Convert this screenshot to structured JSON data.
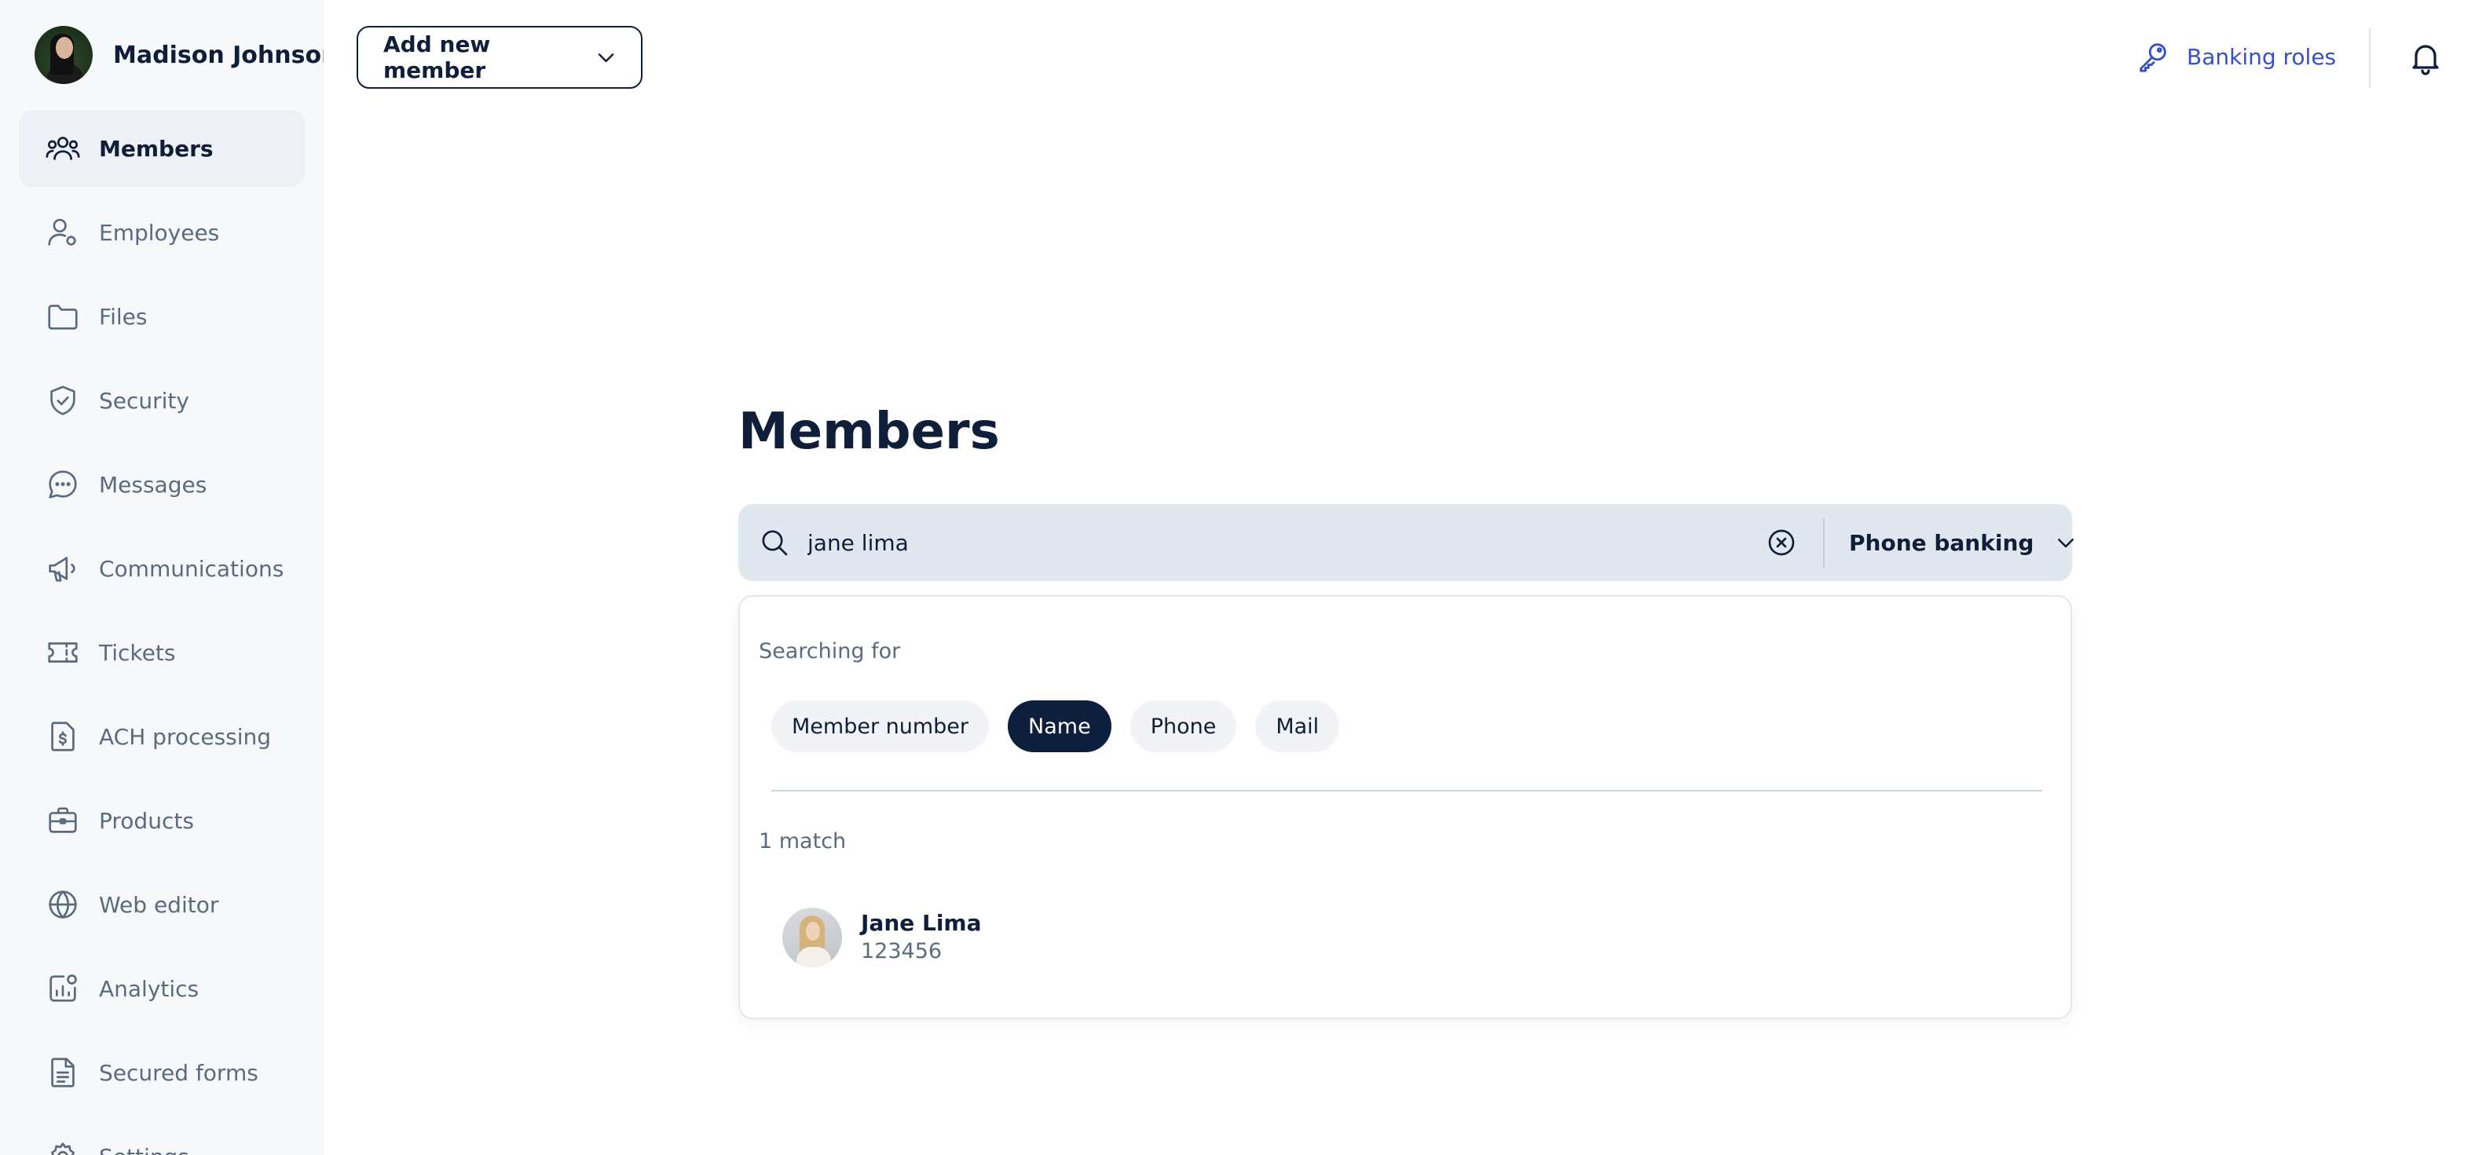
{
  "user": {
    "name": "Madison Johnson"
  },
  "header": {
    "add_member_label": "Add new member",
    "banking_roles_label": "Banking roles"
  },
  "sidebar": {
    "items": [
      {
        "label": "Members",
        "icon": "members-icon",
        "active": true
      },
      {
        "label": "Employees",
        "icon": "employee-icon"
      },
      {
        "label": "Files",
        "icon": "folder-icon"
      },
      {
        "label": "Security",
        "icon": "shield-check-icon"
      },
      {
        "label": "Messages",
        "icon": "chat-bubble-icon"
      },
      {
        "label": "Communications",
        "icon": "megaphone-icon"
      },
      {
        "label": "Tickets",
        "icon": "ticket-icon"
      },
      {
        "label": "ACH processing",
        "icon": "dollar-document-icon"
      },
      {
        "label": "Products",
        "icon": "briefcase-icon"
      },
      {
        "label": "Web editor",
        "icon": "globe-icon"
      },
      {
        "label": "Analytics",
        "icon": "analytics-icon"
      },
      {
        "label": "Secured forms",
        "icon": "document-icon"
      },
      {
        "label": "Settings",
        "icon": "gear-icon"
      }
    ]
  },
  "main": {
    "title": "Members",
    "search": {
      "value": "jane lima",
      "scope_label": "Phone banking"
    },
    "results": {
      "searching_for_label": "Searching for",
      "filters": [
        {
          "label": "Member number",
          "active": false
        },
        {
          "label": "Name",
          "active": true
        },
        {
          "label": "Phone",
          "active": false
        },
        {
          "label": "Mail",
          "active": false
        }
      ],
      "match_count": "1 match",
      "items": [
        {
          "name": "Jane Lima",
          "number": "123456"
        }
      ]
    }
  },
  "colors": {
    "accent_link": "#3550c8",
    "dark_navy": "#0d1f3c",
    "search_bg": "#e1e7ef",
    "sidebar_bg": "#f6f8fa"
  }
}
